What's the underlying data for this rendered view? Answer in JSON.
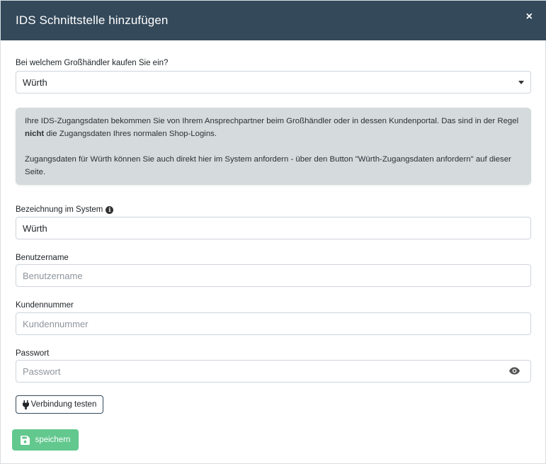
{
  "dialog": {
    "title": "IDS Schnittstelle hinzufügen",
    "close_label": "×"
  },
  "wholesaler": {
    "label": "Bei welchem Großhändler kaufen Sie ein?",
    "selected": "Würth"
  },
  "info": {
    "line1_pre": "Ihre IDS-Zugangsdaten bekommen Sie von Ihrem Ansprechpartner beim Großhändler oder in dessen Kundenportal. Das sind in der Regel ",
    "line1_bold": "nicht",
    "line1_post": " die Zugangsdaten Ihres normalen Shop-Logins.",
    "line2": "Zugangsdaten für Würth können Sie auch direkt hier im System anfordern - über den Button \"Würth-Zugangsdaten anfordern\" auf dieser Seite."
  },
  "system_name": {
    "label": "Bezeichnung im System",
    "value": "Würth"
  },
  "username": {
    "label": "Benutzername",
    "placeholder": "Benutzername",
    "value": ""
  },
  "customer_number": {
    "label": "Kundennummer",
    "placeholder": "Kundennummer",
    "value": ""
  },
  "password": {
    "label": "Passwort",
    "placeholder": "Passwort",
    "value": ""
  },
  "buttons": {
    "test_connection": "Verbindung testen",
    "save": "speichern"
  },
  "colors": {
    "header": "#34495a",
    "save_button": "#62c88e",
    "info_box": "#d5dadd"
  },
  "icons": {
    "close": "close-icon",
    "info": "info-icon",
    "eye": "eye-icon",
    "plug": "plug-icon",
    "save": "floppy-disk-icon",
    "dropdown": "caret-down-icon"
  }
}
